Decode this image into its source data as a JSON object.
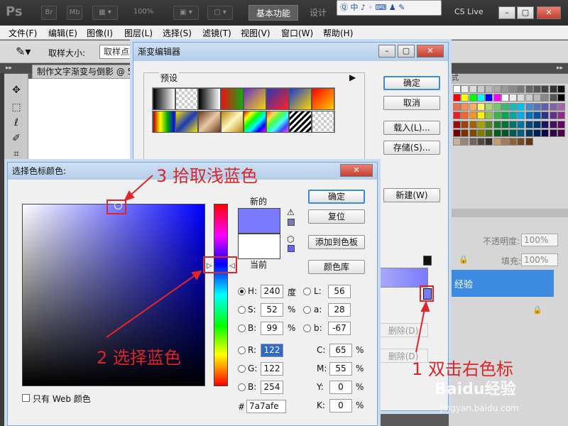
{
  "app": {
    "logo": "Ps",
    "bridge_btn": "Br",
    "minibridge_btn": "Mb",
    "zoom": "100%",
    "workspace_active": "基本功能",
    "workspace_other": "设计",
    "cs_live": "CS Live",
    "ime_text": "中"
  },
  "menubar": [
    "文件(F)",
    "编辑(E)",
    "图像(I)",
    "图层(L)",
    "选择(S)",
    "滤镜(T)",
    "视图(V)",
    "窗口(W)",
    "帮助(H)"
  ],
  "options": {
    "sample_label": "取样大小:",
    "sample_value": "取样点"
  },
  "doc_tab": "制作文字渐变与倒影 @ 5",
  "gradient_editor": {
    "title": "渐变编辑器",
    "presets_label": "预设",
    "ok": "确定",
    "cancel": "取消",
    "load": "载入(L)...",
    "save": "存储(S)...",
    "new": "新建(W)",
    "delete1": "删除(D)",
    "delete2": "删除(D)"
  },
  "color_picker": {
    "title": "选择色标颜色:",
    "new_label": "新的",
    "current_label": "当前",
    "new_color": "#7a7afe",
    "current_color": "#ffffff",
    "ok": "确定",
    "reset": "复位",
    "add_swatch": "添加到色板",
    "libraries": "颜色库",
    "web_only": "只有 Web 颜色",
    "hsb": [
      {
        "k": "H:",
        "v": "240",
        "u": "度"
      },
      {
        "k": "S:",
        "v": "52",
        "u": "%"
      },
      {
        "k": "B:",
        "v": "99",
        "u": "%"
      }
    ],
    "lab": [
      {
        "k": "L:",
        "v": "56"
      },
      {
        "k": "a:",
        "v": "28"
      },
      {
        "k": "b:",
        "v": "-67"
      }
    ],
    "rgb": [
      {
        "k": "R:",
        "v": "122"
      },
      {
        "k": "G:",
        "v": "122"
      },
      {
        "k": "B:",
        "v": "254"
      }
    ],
    "cmyk": [
      {
        "k": "C:",
        "v": "65",
        "u": "%"
      },
      {
        "k": "M:",
        "v": "55",
        "u": "%"
      },
      {
        "k": "Y:",
        "v": "0",
        "u": "%"
      },
      {
        "k": "K:",
        "v": "0",
        "u": "%"
      }
    ],
    "hex_label": "#",
    "hex": "7a7afe"
  },
  "layers": {
    "opacity_label": "不透明度:",
    "opacity": "100%",
    "fill_label": "填充:",
    "fill": "100%",
    "layer_name": "经验"
  },
  "annotations": {
    "step1": "1 双击右色标",
    "step2": "2 选择蓝色",
    "step3": "3 拾取浅蓝色"
  },
  "watermark": {
    "brand": "Baidu经验",
    "url": "jingyan.baidu.com"
  }
}
